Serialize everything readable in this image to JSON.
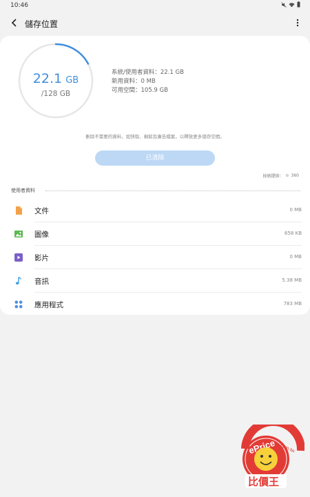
{
  "status_bar": {
    "time": "10:46"
  },
  "header": {
    "title": "儲存位置"
  },
  "storage": {
    "used_value": "22.1",
    "used_unit": "GB",
    "total": "/128 GB",
    "used_fraction": 0.173
  },
  "info": {
    "system": "系統/使用者資料：22.1 GB",
    "new": "新用資料：0 MB",
    "available": "可用空間：105.9 GB"
  },
  "tip": "刪除不需要的資料，如快取、剩餘及廣告檔案，以釋放更多儲存空間。",
  "clean_button": "已清除",
  "provider": {
    "label": "技術提供：",
    "name": "360"
  },
  "section_title": "使用者資料",
  "items": [
    {
      "label": "文件",
      "size": "0 MB",
      "icon": "document-icon",
      "color": "#f3a24a"
    },
    {
      "label": "圖像",
      "size": "658 KB",
      "icon": "image-icon",
      "color": "#5ab84f"
    },
    {
      "label": "影片",
      "size": "0 MB",
      "icon": "video-icon",
      "color": "#7b5fc8"
    },
    {
      "label": "音訊",
      "size": "5.38 MB",
      "icon": "audio-icon",
      "color": "#3e9be0"
    },
    {
      "label": "應用程式",
      "size": "783 MB",
      "icon": "apps-icon",
      "color": "#4f8fe0"
    }
  ],
  "watermark": {
    "text": "ePrice.com.tw",
    "brand": "比價王"
  },
  "colors": {
    "accent": "#3e8edc",
    "button_disabled": "#bcd8f5"
  }
}
